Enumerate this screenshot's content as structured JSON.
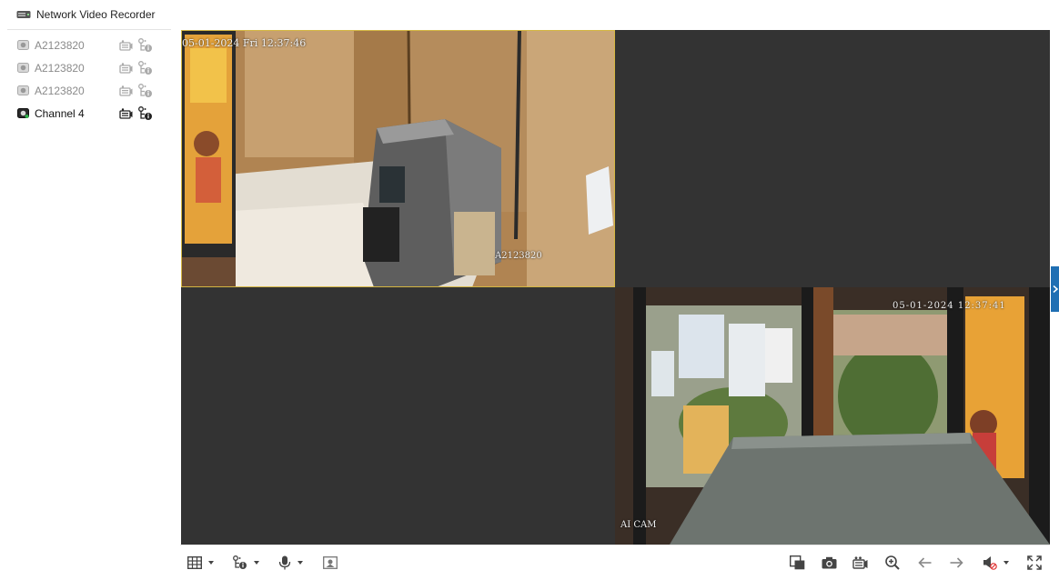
{
  "sidebar": {
    "device_title": "Network Video Recorder",
    "channels": [
      {
        "label": "A2123820",
        "active": false
      },
      {
        "label": "A2123820",
        "active": false
      },
      {
        "label": "A2123820",
        "active": false
      },
      {
        "label": "Channel 4",
        "active": true
      }
    ]
  },
  "grid": {
    "layout": "2x2",
    "cells": [
      {
        "state": "live",
        "selected": true,
        "timestamp": "05-01-2024 Fri 12:37:46",
        "camera_label": "A2123820"
      },
      {
        "state": "empty"
      },
      {
        "state": "empty"
      },
      {
        "state": "live",
        "selected": false,
        "timestamp": "05-01-2024 12:37:41",
        "camera_label": "AI CAM"
      }
    ]
  },
  "toolbar": {
    "left": [
      "window-layout-icon",
      "stream-type-icon",
      "microphone-icon",
      "digital-zoom-box-icon"
    ],
    "right": [
      "close-all-windows-icon",
      "camera-snapshot-icon",
      "record-icon",
      "zoom-in-icon",
      "previous-page-icon",
      "next-page-icon",
      "volume-muted-icon",
      "fullscreen-icon"
    ]
  },
  "colors": {
    "selected_border": "#d4b642",
    "empty_cell": "#333333",
    "handle": "#1f6fb3",
    "active_text": "#111111",
    "inactive_text": "#8a8a8a"
  }
}
